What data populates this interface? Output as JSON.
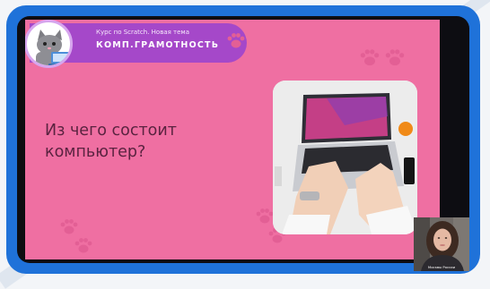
{
  "slide": {
    "banner_subtitle": "Курс по Scratch. Новая тема",
    "banner_title": "КОМП.ГРАМОТНОСТЬ",
    "heading_lines": [
      "Из чего состоит",
      "компьютер?"
    ]
  },
  "webcam": {
    "label": "Москвы России"
  },
  "colors": {
    "frame": "#1f72d9",
    "slide_background": "#ef6fa2",
    "banner": "#a548c9",
    "heading_text": "#5a2340"
  }
}
